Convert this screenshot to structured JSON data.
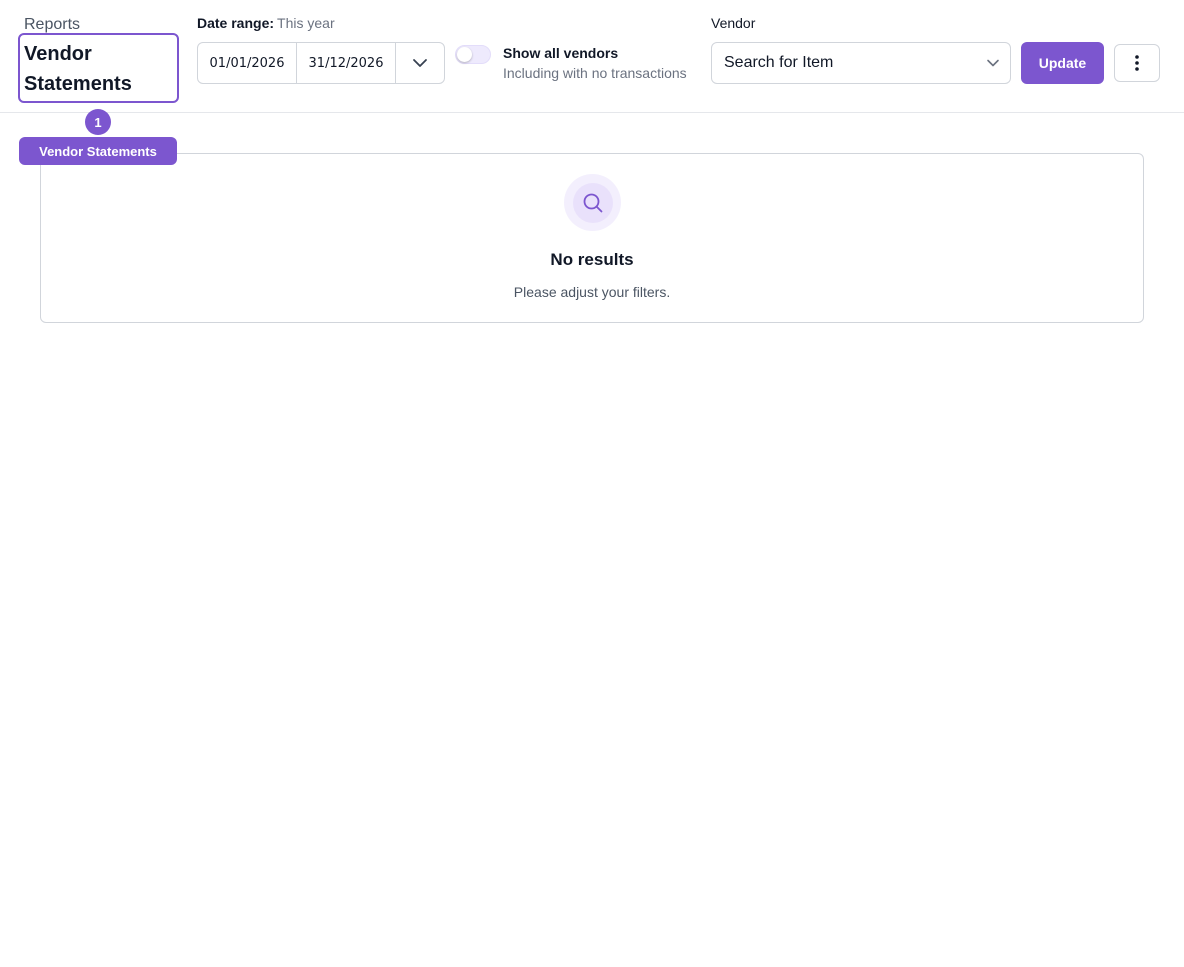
{
  "header": {
    "breadcrumb": "Reports",
    "title": "Vendor Statements"
  },
  "annotation": {
    "number": "1",
    "label": "Vendor Statements"
  },
  "filters": {
    "date_range_label": "Date range:",
    "date_range_preset": "This year",
    "start_date": "01/01/2026",
    "end_date": "31/12/2026",
    "show_all_title": "Show all vendors",
    "show_all_subtitle": "Including with no transactions",
    "show_all_enabled": false,
    "vendor_label": "Vendor",
    "vendor_placeholder": "Search for Item",
    "update_label": "Update"
  },
  "results": {
    "empty_title": "No results",
    "empty_subtitle": "Please adjust your filters."
  },
  "colors": {
    "accent": "#7c56cf",
    "border": "#d1d5db"
  },
  "icons": {
    "date_dropdown": "chevron-down-icon",
    "vendor_dropdown": "chevron-down-icon",
    "more": "more-vertical-icon",
    "empty_state": "search-icon"
  }
}
